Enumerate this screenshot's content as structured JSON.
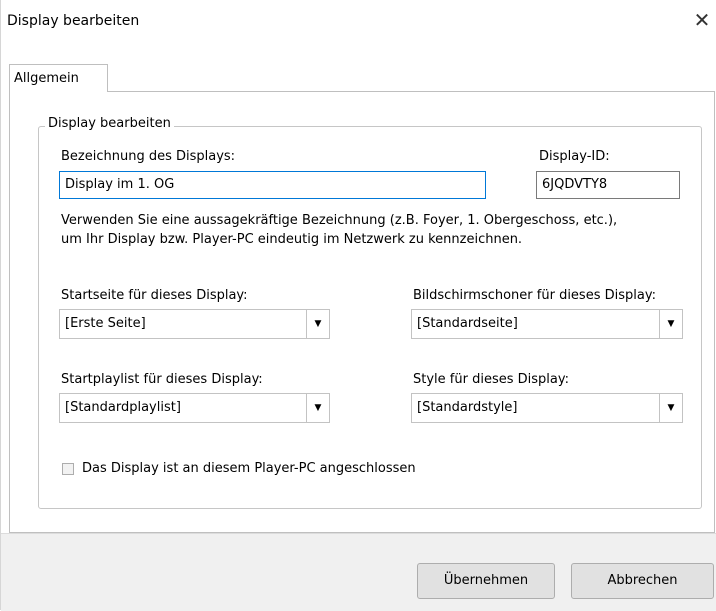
{
  "window": {
    "title": "Display bearbeiten"
  },
  "icons": {
    "close": "close-icon",
    "dropdown": "chevron-down-icon"
  },
  "tabs": [
    {
      "label": "Allgemein"
    }
  ],
  "group": {
    "title": "Display bearbeiten",
    "name_label": "Bezeichnung des Displays:",
    "name_value": "Display im 1. OG",
    "id_label": "Display-ID:",
    "id_value": "6JQDVTY8",
    "hint_line1": "Verwenden Sie eine aussagekräftige Bezeichnung (z.B. Foyer, 1. Obergeschoss, etc.),",
    "hint_line2": "um Ihr Display bzw. Player-PC eindeutig im Netzwerk zu kennzeichnen.",
    "startpage_label": "Startseite für dieses Display:",
    "startpage_value": "[Erste Seite]",
    "screensaver_label": "Bildschirmschoner für dieses Display:",
    "screensaver_value": "[Standardseite]",
    "playlist_label": "Startplaylist für dieses Display:",
    "playlist_value": "[Standardplaylist]",
    "style_label": "Style für dieses Display:",
    "style_value": "[Standardstyle]",
    "connected_label": "Das Display ist an diesem Player-PC angeschlossen",
    "connected_checked": false
  },
  "buttons": {
    "apply": "Übernehmen",
    "cancel": "Abbrechen"
  }
}
